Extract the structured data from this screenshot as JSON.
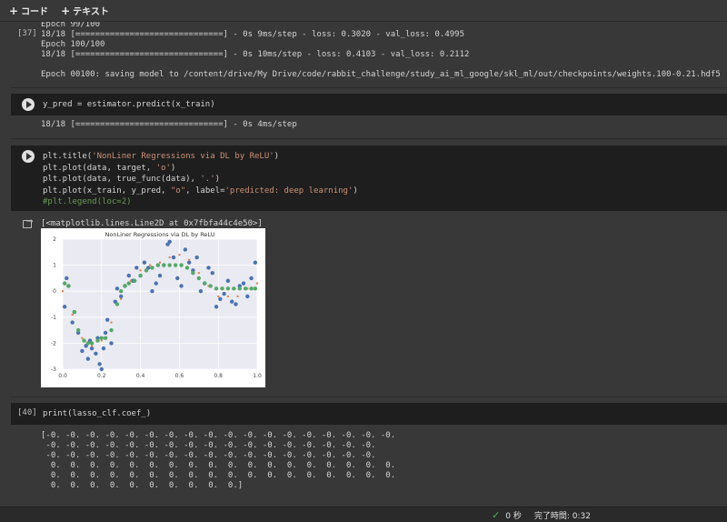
{
  "toolbar": {
    "add_code_label": "コード",
    "add_text_label": "テキスト"
  },
  "cell37": {
    "exec_count": "[37]",
    "output_lines": [
      "Epoch 99/100",
      "18/18 [==============================] - 0s 9ms/step - loss: 0.3020 - val_loss: 0.4995",
      "Epoch 100/100",
      "18/18 [==============================] - 0s 10ms/step - loss: 0.4103 - val_loss: 0.2112",
      "",
      "Epoch 00100: saving model to /content/drive/My Drive/code/rabbit_challenge/study_ai_ml_google/skl_ml/out/checkpoints/weights.100-0.21.hdf5"
    ]
  },
  "cell38": {
    "code": "y_pred = estimator.predict(x_train)",
    "output": "18/18 [==============================] - 0s 4ms/step"
  },
  "cell39": {
    "code_lines": [
      {
        "pre": "plt.title(",
        "str": "'NonLiner Regressions via DL by ReLU'",
        "post": ")"
      },
      {
        "pre": "plt.plot(data, target, ",
        "str": "'o'",
        "post": ")"
      },
      {
        "pre": "plt.plot(data, true_func(data), ",
        "str": "'.'",
        "post": ")"
      },
      {
        "pre": "plt.plot(x_train, y_pred, ",
        "str": "\"o\"",
        "post": ", label=",
        "str2": "'predicted: deep learning'",
        "post2": ")"
      },
      {
        "comment": "#plt.legend(loc=2)"
      }
    ],
    "output_text": "[<matplotlib.lines.Line2D at 0x7fbfa44c4e50>]"
  },
  "cell40": {
    "exec_count": "[40]",
    "code": "print(lasso_clf.coef_)",
    "output_lines": [
      "[-0. -0. -0. -0. -0. -0. -0. -0. -0. -0. -0. -0. -0. -0. -0. -0. -0. -0.",
      " -0. -0. -0. -0. -0. -0. -0. -0. -0. -0. -0. -0. -0. -0. -0. -0. -0.",
      " -0. -0. -0. -0. -0. -0. -0. -0. -0. -0. -0. -0. -0. -0. -0. -0. -0.",
      "  0.  0.  0.  0.  0.  0.  0.  0.  0.  0.  0.  0.  0.  0.  0.  0.  0.  0.",
      "  0.  0.  0.  0.  0.  0.  0.  0.  0.  0.  0.  0.  0.  0.  0.  0.  0.  0.",
      "  0.  0.  0.  0.  0.  0.  0.  0.  0.  0.]"
    ]
  },
  "statusbar": {
    "seconds": "0 秒",
    "completed": "完了時間: 0:32"
  },
  "chart_data": {
    "type": "scatter",
    "title": "NonLiner Regressions via DL by ReLU",
    "xlim": [
      0.0,
      1.0
    ],
    "ylim": [
      -3,
      2
    ],
    "x_ticks": [
      "0.0",
      "0.2",
      "0.4",
      "0.6",
      "0.8",
      "1.0"
    ],
    "y_ticks": [
      "2",
      "1",
      "0",
      "-1",
      "-2",
      "-3"
    ],
    "colors": {
      "target": "#4c72b0",
      "true_func": "#dd8452",
      "predicted": "#55a868",
      "bg": "#eaeaf2"
    },
    "series": [
      {
        "kind": "target",
        "x": [
          0.01,
          0.02,
          0.03,
          0.05,
          0.06,
          0.08,
          0.1,
          0.12,
          0.13,
          0.14,
          0.15,
          0.17,
          0.18,
          0.19,
          0.2,
          0.21,
          0.22,
          0.23,
          0.25,
          0.27,
          0.28,
          0.3,
          0.32,
          0.34,
          0.36,
          0.38,
          0.4,
          0.42,
          0.44,
          0.46,
          0.48,
          0.5,
          0.52,
          0.54,
          0.55,
          0.57,
          0.59,
          0.61,
          0.63,
          0.65,
          0.67,
          0.69,
          0.71,
          0.73,
          0.75,
          0.77,
          0.79,
          0.81,
          0.83,
          0.85,
          0.87,
          0.89,
          0.91,
          0.93,
          0.95,
          0.97,
          0.99
        ],
        "y": [
          -0.6,
          0.5,
          0.2,
          -1.2,
          -0.8,
          -1.6,
          -2.3,
          -2.1,
          -2.6,
          -1.9,
          -2.2,
          -2.4,
          -1.8,
          -2.8,
          -3.0,
          -2.2,
          -1.6,
          -1.1,
          -2.0,
          -0.4,
          0.1,
          -0.2,
          0.2,
          0.6,
          0.4,
          0.9,
          0.6,
          1.1,
          0.9,
          0.0,
          0.3,
          0.6,
          1.0,
          1.8,
          1.9,
          1.3,
          0.5,
          0.2,
          1.6,
          1.1,
          0.8,
          1.3,
          0.0,
          0.3,
          0.9,
          0.7,
          -0.6,
          -0.3,
          -0.1,
          0.4,
          -0.4,
          -0.5,
          0.2,
          0.3,
          -0.2,
          0.5,
          1.1
        ]
      },
      {
        "kind": "true_func",
        "x": [
          0.0,
          0.05,
          0.1,
          0.15,
          0.2,
          0.25,
          0.3,
          0.35,
          0.4,
          0.45,
          0.5,
          0.55,
          0.6,
          0.65,
          0.7,
          0.75,
          0.8,
          0.85,
          0.9,
          0.95,
          1.0
        ],
        "y": [
          0.0,
          -0.9,
          -1.8,
          -2.1,
          -1.9,
          -1.2,
          -0.3,
          0.4,
          0.8,
          1.0,
          1.1,
          1.3,
          1.4,
          1.2,
          0.7,
          0.2,
          -0.2,
          -0.2,
          -0.2,
          0.1,
          0.3
        ]
      },
      {
        "kind": "predicted",
        "x": [
          0.01,
          0.03,
          0.06,
          0.08,
          0.11,
          0.13,
          0.15,
          0.18,
          0.2,
          0.22,
          0.25,
          0.28,
          0.3,
          0.32,
          0.34,
          0.37,
          0.4,
          0.43,
          0.46,
          0.49,
          0.52,
          0.55,
          0.58,
          0.61,
          0.64,
          0.67,
          0.7,
          0.73,
          0.76,
          0.79,
          0.82,
          0.85,
          0.88,
          0.91,
          0.94,
          0.97,
          0.99
        ],
        "y": [
          0.3,
          0.2,
          -0.8,
          -1.5,
          -1.9,
          -2.0,
          -2.0,
          -1.9,
          -1.8,
          -1.8,
          -1.5,
          -0.5,
          0.0,
          0.2,
          0.3,
          0.4,
          0.6,
          0.8,
          0.9,
          1.0,
          1.0,
          1.0,
          1.0,
          1.0,
          0.9,
          0.7,
          0.5,
          0.3,
          0.2,
          0.1,
          0.1,
          0.1,
          0.1,
          0.1,
          0.1,
          0.1,
          0.1
        ]
      }
    ]
  }
}
